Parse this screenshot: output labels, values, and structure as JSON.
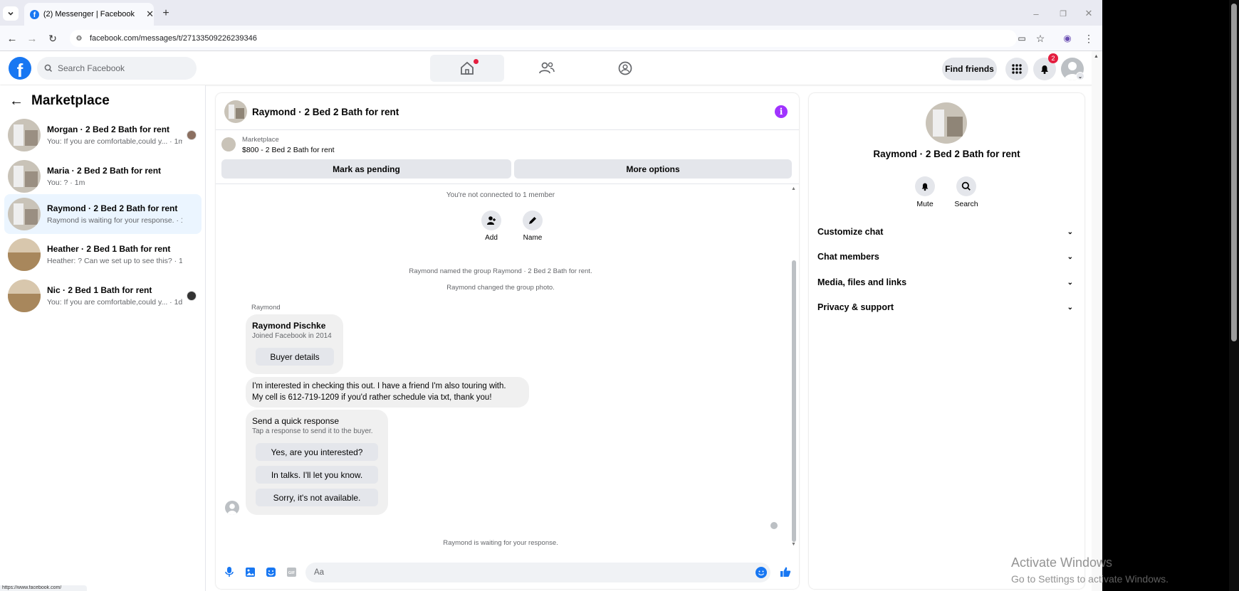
{
  "browser": {
    "tab_title": "(2) Messenger | Facebook",
    "url": "facebook.com/messages/t/27133509226239346",
    "status_url": "https://www.facebook.com/"
  },
  "header": {
    "search_placeholder": "Search Facebook",
    "find_friends": "Find friends",
    "notification_count": "2"
  },
  "sidebar": {
    "title": "Marketplace",
    "conversations": [
      {
        "name": "Morgan · 2 Bed 2 Bath for rent",
        "preview": "You: If you are comfortable,could y... · 1m"
      },
      {
        "name": "Maria · 2 Bed 2 Bath for rent",
        "preview": "You: ? · 1m"
      },
      {
        "name": "Raymond · 2 Bed 2 Bath for rent",
        "preview": "Raymond is waiting for your response. · 13h"
      },
      {
        "name": "Heather · 2 Bed 1 Bath for rent",
        "preview": "Heather: ? Can we set up to see this? · 1d"
      },
      {
        "name": "Nic · 2 Bed 1 Bath for rent",
        "preview": "You: If you are comfortable,could y... · 1d"
      }
    ]
  },
  "chat": {
    "title": "Raymond · 2 Bed 2 Bath for rent",
    "listing_source": "Marketplace",
    "listing_price": "$800 - 2 Bed 2 Bath for rent",
    "mark_pending": "Mark as pending",
    "more_options": "More options",
    "not_connected": "You're not connected to 1 member",
    "add_label": "Add",
    "name_label": "Name",
    "event_named": "Raymond named the group Raymond · 2 Bed 2 Bath for rent.",
    "event_photo": "Raymond changed the group photo.",
    "sender_name": "Raymond",
    "buyer_name": "Raymond Pischke",
    "buyer_joined": "Joined Facebook in 2014",
    "buyer_details": "Buyer details",
    "message_line1": "I'm interested in checking this out. I have a friend I'm also touring with.",
    "message_line2": "My cell is 612-719-1209 if you'd rather schedule via txt, thank you!",
    "quick_title": "Send a quick response",
    "quick_sub": "Tap a response to send it to the buyer.",
    "quick_replies": [
      "Yes, are you interested?",
      "In talks. I'll let you know.",
      "Sorry, it's not available."
    ],
    "waiting": "Raymond is waiting for your response.",
    "composer_placeholder": "Aa"
  },
  "info_panel": {
    "title": "Raymond · 2 Bed 2 Bath for rent",
    "mute": "Mute",
    "search": "Search",
    "sections": [
      "Customize chat",
      "Chat members",
      "Media, files and links",
      "Privacy & support"
    ]
  },
  "watermark": {
    "line1": "Activate Windows",
    "line2": "Go to Settings to activate Windows."
  },
  "colors": {
    "brand": "#1877f2",
    "accent_purple": "#a033ff",
    "active_row": "#ebf5ff"
  }
}
